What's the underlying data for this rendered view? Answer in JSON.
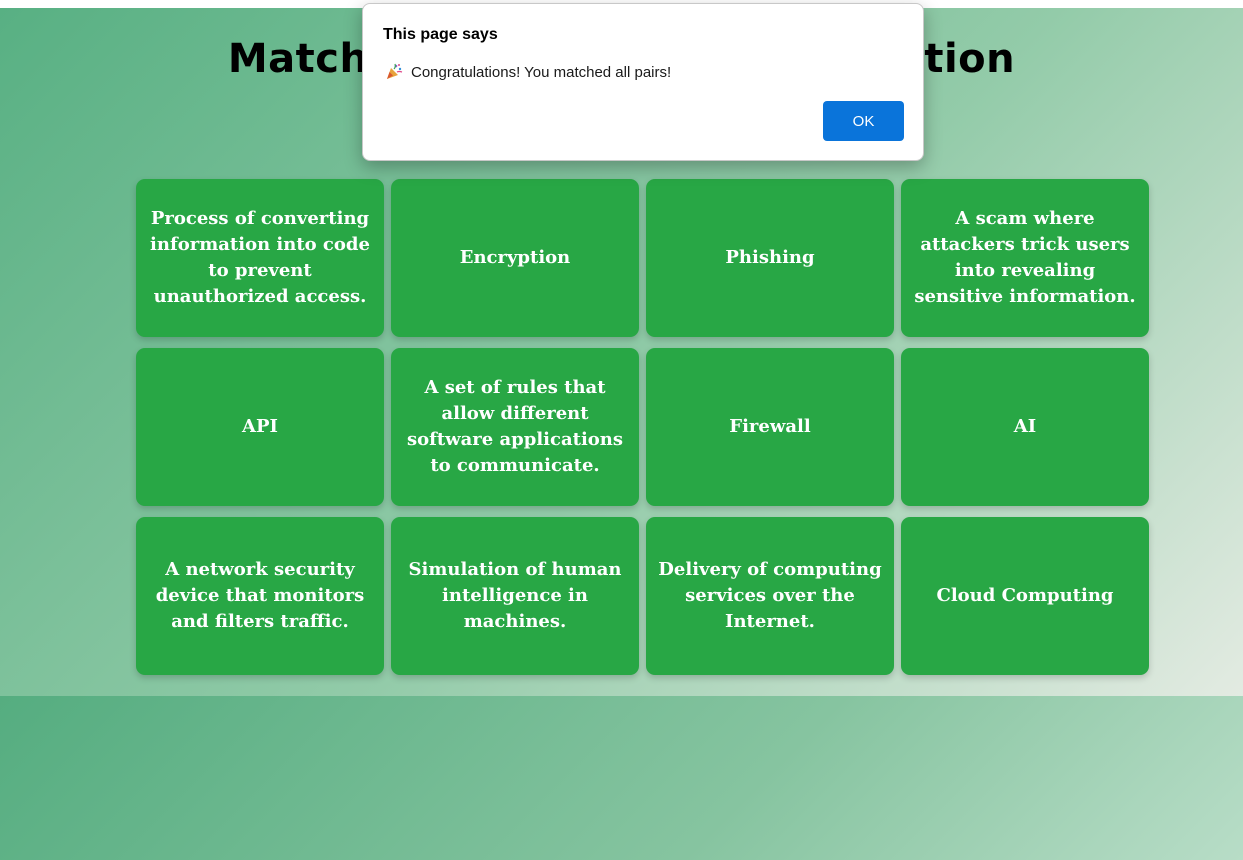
{
  "page": {
    "title": "Match the Term with its Definition"
  },
  "cards": [
    {
      "text": "Process of converting information into code to prevent unauthorized access."
    },
    {
      "text": "Encryption"
    },
    {
      "text": "Phishing"
    },
    {
      "text": "A scam where attackers trick users into revealing sensitive information."
    },
    {
      "text": "API"
    },
    {
      "text": "A set of rules that allow different software applications to communicate."
    },
    {
      "text": "Firewall"
    },
    {
      "text": "AI"
    },
    {
      "text": "A network security device that monitors and filters traffic."
    },
    {
      "text": "Simulation of human intelligence in machines."
    },
    {
      "text": "Delivery of computing services over the Internet."
    },
    {
      "text": "Cloud Computing"
    }
  ],
  "dialog": {
    "title": "This page says",
    "message": "Congratulations! You matched all pairs!",
    "icon": "party-popper-icon",
    "ok_label": "OK"
  },
  "colors": {
    "card": "#28a745",
    "ok_button": "#0a74da"
  }
}
